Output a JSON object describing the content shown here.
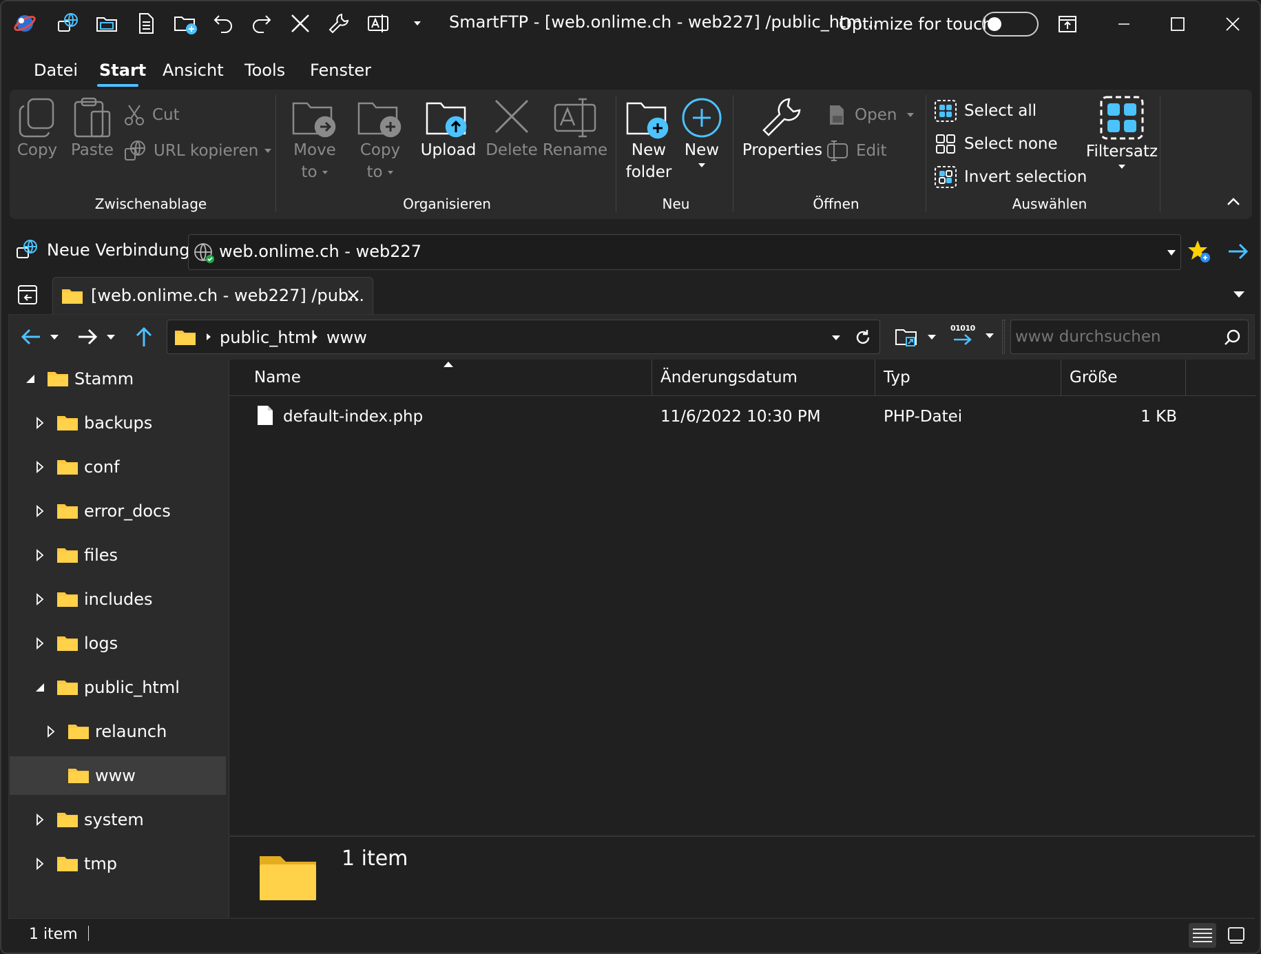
{
  "window": {
    "title": "SmartFTP - [web.onlime.ch - web227] /public_htm...",
    "touch_label": "Optimize for touch"
  },
  "menu": {
    "items": [
      "Datei",
      "Start",
      "Ansicht",
      "Tools",
      "Fenster"
    ],
    "active": "Start"
  },
  "ribbon": {
    "copy": "Copy",
    "paste": "Paste",
    "cut": "Cut",
    "url_copy": "URL kopieren",
    "move_to": [
      "Move",
      "to"
    ],
    "copy_to": [
      "Copy",
      "to"
    ],
    "upload": "Upload",
    "delete": "Delete",
    "rename": "Rename",
    "new_folder": [
      "New",
      "folder"
    ],
    "new": "New",
    "properties": "Properties",
    "open": "Open",
    "edit": "Edit",
    "select_all": "Select all",
    "select_none": "Select none",
    "invert_selection": "Invert selection",
    "filtersatz": "Filtersatz",
    "groups": {
      "clipboard": "Zwischenablage",
      "organize": "Organisieren",
      "new": "Neu",
      "open": "Öffnen",
      "select": "Auswählen"
    }
  },
  "connection": {
    "new_connection": "Neue Verbindung",
    "selected": "web.onlime.ch - web227"
  },
  "tab": {
    "label": "[web.onlime.ch - web227] /pub..."
  },
  "path": {
    "segments": [
      "public_html",
      "www"
    ],
    "search_placeholder": "www durchsuchen",
    "transfer_label": "01010"
  },
  "tree": [
    {
      "label": "Stamm",
      "expanded": true
    },
    {
      "label": "backups"
    },
    {
      "label": "conf"
    },
    {
      "label": "error_docs"
    },
    {
      "label": "files"
    },
    {
      "label": "includes"
    },
    {
      "label": "logs"
    },
    {
      "label": "public_html",
      "expanded": true
    },
    {
      "label": "relaunch"
    },
    {
      "label": "www",
      "selected": true
    },
    {
      "label": "system"
    },
    {
      "label": "tmp"
    }
  ],
  "list": {
    "columns": [
      "Name",
      "Änderungsdatum",
      "Typ",
      "Größe"
    ],
    "rows": [
      {
        "name": "default-index.php",
        "date": "11/6/2022 10:30 PM",
        "type": "PHP-Datei",
        "size": "1 KB"
      }
    ]
  },
  "details": {
    "count": "1 item"
  },
  "status": {
    "count": "1 item"
  },
  "colors": {
    "accent": "#4cc2ff",
    "folder": "#ffd24a",
    "star": "#ffd100"
  }
}
